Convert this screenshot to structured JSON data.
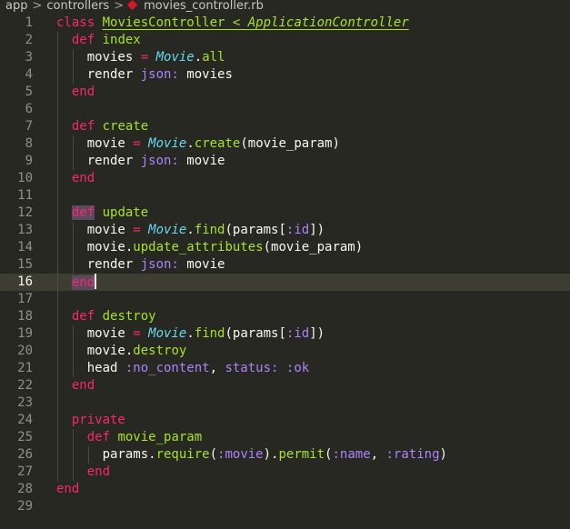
{
  "breadcrumb": {
    "parts": [
      "app",
      "controllers"
    ],
    "file": "movies_controller.rb"
  },
  "editor": {
    "current_line": 16,
    "lines": [
      [
        [
          "k",
          "class"
        ],
        [
          "p",
          " "
        ],
        [
          "u",
          "MoviesController"
        ],
        [
          "u",
          " < "
        ],
        [
          "ui",
          "ApplicationController"
        ]
      ],
      [
        [
          "p",
          "  "
        ],
        [
          "k",
          "def"
        ],
        [
          "p",
          " "
        ],
        [
          "f",
          "index"
        ]
      ],
      [
        [
          "p",
          "    movies "
        ],
        [
          "o",
          "="
        ],
        [
          "p",
          " "
        ],
        [
          "c",
          "Movie"
        ],
        [
          "p",
          "."
        ],
        [
          "f",
          "all"
        ]
      ],
      [
        [
          "p",
          "    render "
        ],
        [
          "j",
          "json:"
        ],
        [
          "p",
          " movies"
        ]
      ],
      [
        [
          "p",
          "  "
        ],
        [
          "k",
          "end"
        ]
      ],
      [],
      [
        [
          "p",
          "  "
        ],
        [
          "k",
          "def"
        ],
        [
          "p",
          " "
        ],
        [
          "f",
          "create"
        ]
      ],
      [
        [
          "p",
          "    movie "
        ],
        [
          "o",
          "="
        ],
        [
          "p",
          " "
        ],
        [
          "c",
          "Movie"
        ],
        [
          "p",
          "."
        ],
        [
          "f",
          "create"
        ],
        [
          "p",
          "(movie_param)"
        ]
      ],
      [
        [
          "p",
          "    render "
        ],
        [
          "j",
          "json:"
        ],
        [
          "p",
          " movie"
        ]
      ],
      [
        [
          "p",
          "  "
        ],
        [
          "k",
          "end"
        ]
      ],
      [],
      [
        [
          "p",
          "  "
        ],
        [
          "k sel",
          "def"
        ],
        [
          "p",
          " "
        ],
        [
          "f",
          "update"
        ]
      ],
      [
        [
          "p",
          "    movie "
        ],
        [
          "o",
          "="
        ],
        [
          "p",
          " "
        ],
        [
          "c",
          "Movie"
        ],
        [
          "p",
          "."
        ],
        [
          "f",
          "find"
        ],
        [
          "p",
          "(params["
        ],
        [
          "s",
          ":id"
        ],
        [
          "p",
          "])"
        ]
      ],
      [
        [
          "p",
          "    movie."
        ],
        [
          "f",
          "update_attributes"
        ],
        [
          "p",
          "(movie_param)"
        ]
      ],
      [
        [
          "p",
          "    render "
        ],
        [
          "j",
          "json:"
        ],
        [
          "p",
          " movie"
        ]
      ],
      [
        [
          "p",
          "  "
        ],
        [
          "k sel",
          "end"
        ]
      ],
      [],
      [
        [
          "p",
          "  "
        ],
        [
          "k",
          "def"
        ],
        [
          "p",
          " "
        ],
        [
          "f",
          "destroy"
        ]
      ],
      [
        [
          "p",
          "    movie "
        ],
        [
          "o",
          "="
        ],
        [
          "p",
          " "
        ],
        [
          "c",
          "Movie"
        ],
        [
          "p",
          "."
        ],
        [
          "f",
          "find"
        ],
        [
          "p",
          "(params["
        ],
        [
          "s",
          ":id"
        ],
        [
          "p",
          "])"
        ]
      ],
      [
        [
          "p",
          "    movie."
        ],
        [
          "f",
          "destroy"
        ]
      ],
      [
        [
          "p",
          "    head "
        ],
        [
          "s",
          ":no_content"
        ],
        [
          "p",
          ", "
        ],
        [
          "j",
          "status:"
        ],
        [
          "p",
          " "
        ],
        [
          "s",
          ":ok"
        ]
      ],
      [
        [
          "p",
          "  "
        ],
        [
          "k",
          "end"
        ]
      ],
      [],
      [
        [
          "p",
          "  "
        ],
        [
          "k",
          "private"
        ]
      ],
      [
        [
          "p",
          "    "
        ],
        [
          "k",
          "def"
        ],
        [
          "p",
          " "
        ],
        [
          "f",
          "movie_param"
        ]
      ],
      [
        [
          "p",
          "      params."
        ],
        [
          "f",
          "require"
        ],
        [
          "p",
          "("
        ],
        [
          "s",
          ":movie"
        ],
        [
          "p",
          ")."
        ],
        [
          "f",
          "permit"
        ],
        [
          "p",
          "("
        ],
        [
          "s",
          ":name"
        ],
        [
          "p",
          ", "
        ],
        [
          "s",
          ":rating"
        ],
        [
          "p",
          ")"
        ]
      ],
      [
        [
          "p",
          "    "
        ],
        [
          "k",
          "end"
        ]
      ],
      [
        [
          "k",
          "end"
        ]
      ],
      []
    ],
    "line_numbers": [
      "1",
      "2",
      "3",
      "4",
      "5",
      "6",
      "7",
      "8",
      "9",
      "10",
      "11",
      "12",
      "13",
      "14",
      "15",
      "16",
      "17",
      "18",
      "19",
      "20",
      "21",
      "22",
      "23",
      "24",
      "25",
      "26",
      "27",
      "28",
      "29"
    ]
  }
}
